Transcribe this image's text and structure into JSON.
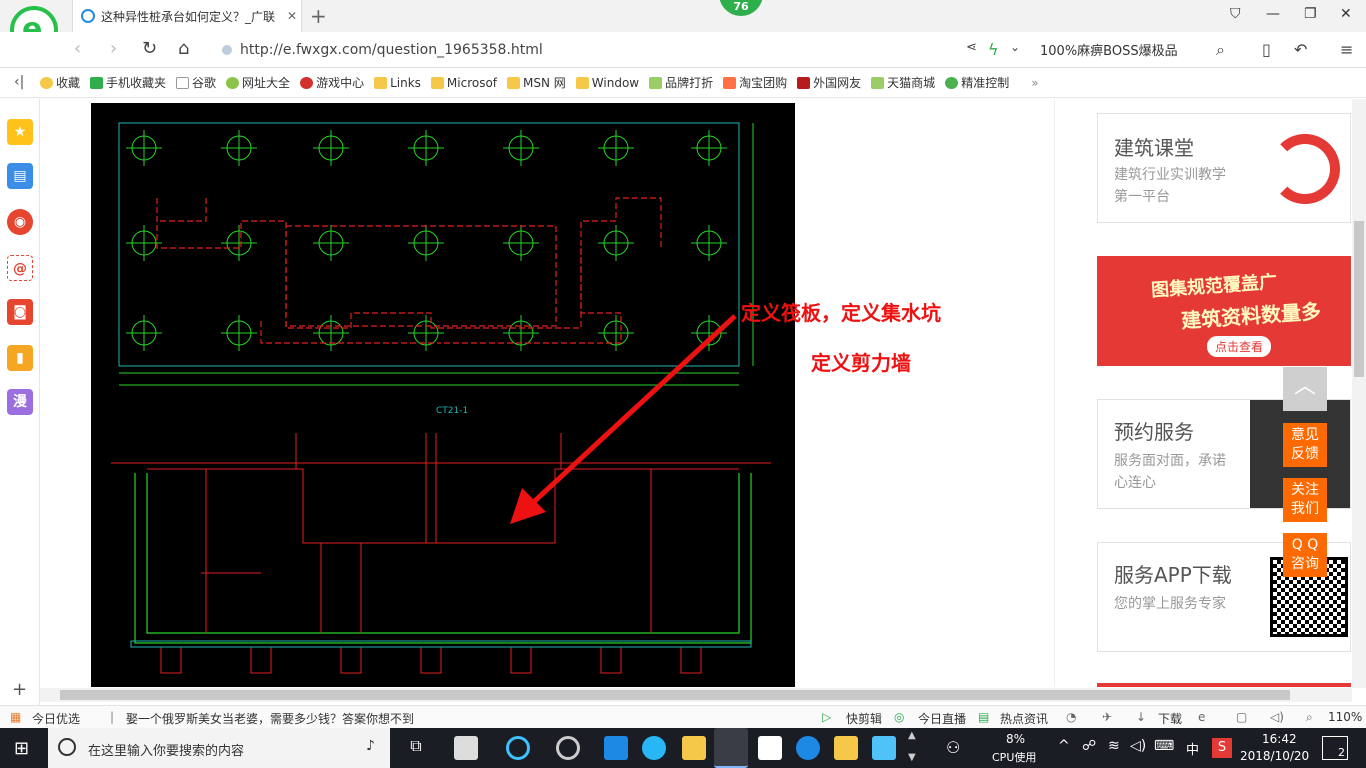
{
  "browser": {
    "tab_title": "这种异性桩承台如何定义？_广联",
    "tab_close": "✕",
    "new_tab": "+",
    "badge": "76",
    "url": "http://e.fwxgx.com/question_1965358.html",
    "search_text": "100%麻痹BOSS爆极品"
  },
  "bookmarks": [
    "收藏",
    "手机收藏夹",
    "谷歌",
    "网址大全",
    "游戏中心",
    "Links",
    "Microsof",
    "MSN 网",
    "Window",
    "品牌打折",
    "淘宝团购",
    "外国网友",
    "天猫商城",
    "精准控制"
  ],
  "sidebar_icons": [
    "star-icon",
    "news-icon",
    "weibo-icon",
    "mail-icon",
    "game-icon",
    "book-icon",
    "comic-icon"
  ],
  "sidebar_comic": "漫",
  "annotation": {
    "line1": "定义筏板，定义集水坑",
    "line2": "定义剪力墙"
  },
  "cad_label": "CT21-1",
  "right": {
    "card1_title": "建筑课堂",
    "card1_desc": "建筑行业实训教学第一平台",
    "banner_line1": "图集规范覆盖广",
    "banner_line2": "建筑资料数量多",
    "banner_btn": "点击查看",
    "card2_title": "预约服务",
    "card2_desc": "服务面对面，承诺心连心",
    "card3_title": "服务APP下载",
    "card3_desc": "您的掌上服务专家"
  },
  "float_buttons": [
    "意见反馈",
    "关注我们",
    "Q Q咨询"
  ],
  "status": {
    "today": "今日优选",
    "headline": "娶一个俄罗斯美女当老婆，需要多少钱？答案你想不到",
    "kuaijian": "快剪辑",
    "live": "今日直播",
    "hotnews": "热点资讯",
    "download": "下载",
    "zoom": "110%"
  },
  "taskbar": {
    "search_placeholder": "在这里输入你要搜索的内容",
    "cpu_percent": "8%",
    "cpu_label": "CPU使用",
    "ime": "中",
    "time": "16:42",
    "date": "2018/10/20",
    "notifications": "2"
  }
}
